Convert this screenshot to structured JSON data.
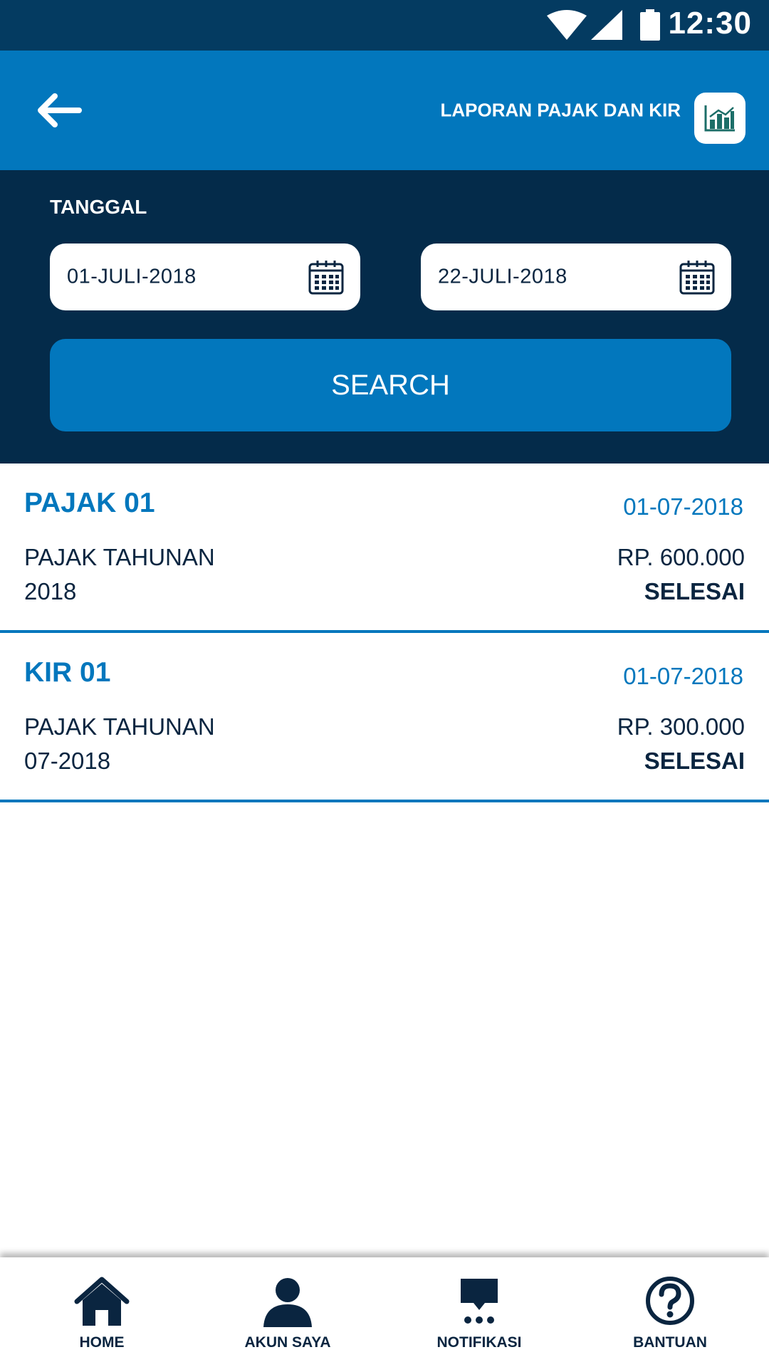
{
  "status_bar": {
    "time": "12:30"
  },
  "header": {
    "title": "LAPORAN PAJAK DAN KIR"
  },
  "filter": {
    "label": "TANGGAL",
    "start_date": "01-JULI-2018",
    "end_date": "22-JULI-2018",
    "search_label": "SEARCH"
  },
  "records": [
    {
      "title": "PAJAK 01",
      "date": "01-07-2018",
      "desc_line1": "PAJAK TAHUNAN",
      "desc_line2": "2018",
      "amount": "RP. 600.000",
      "status": "SELESAI"
    },
    {
      "title": "KIR 01",
      "date": "01-07-2018",
      "desc_line1": "PAJAK TAHUNAN",
      "desc_line2": "07-2018",
      "amount": "RP. 300.000",
      "status": "SELESAI"
    }
  ],
  "nav": {
    "home": "HOME",
    "account": "AKUN SAYA",
    "notifications": "NOTIFIKASI",
    "help": "BANTUAN"
  },
  "colors": {
    "status_bar": "#043b61",
    "header": "#0277bd",
    "filter_panel": "#042b4a",
    "accent": "#0277bd",
    "text_dark": "#0a2540"
  },
  "icons": {
    "back": "arrow-left-icon",
    "report": "bar-chart-icon",
    "calendar": "calendar-icon",
    "home": "home-icon",
    "account": "person-icon",
    "notifications": "chat-notification-icon",
    "help": "question-circle-icon"
  }
}
